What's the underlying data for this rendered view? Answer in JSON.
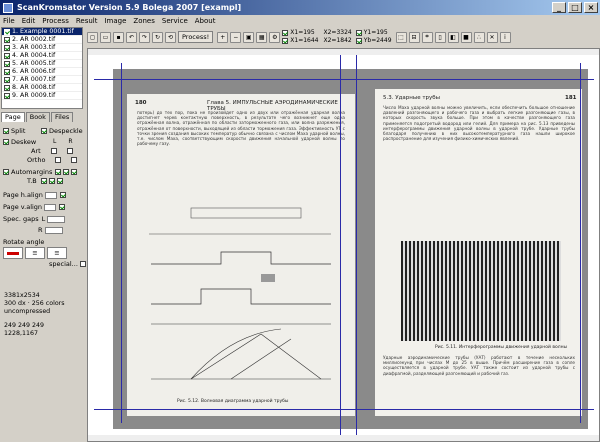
{
  "window": {
    "title": "ScanKromsator     Version 5.9     Bolega 2007     [exampl]"
  },
  "menu": [
    "File",
    "Edit",
    "Process",
    "Result",
    "Image",
    "Zones",
    "Service",
    "About"
  ],
  "files": [
    "1. Example 0001.tif",
    "2. AR 0002.tif",
    "3. AR 0003.tif",
    "4. AR 0004.tif",
    "5. AR 0005.tif",
    "6. AR 0006.tif",
    "7. AR 0007.tif",
    "8. AR 0008.tif",
    "9. AR 0009.tif"
  ],
  "toolbar": {
    "process_label": "Process!"
  },
  "coords": {
    "x1": "X1=195",
    "x2": "X2=3324",
    "y1": "Y1=195",
    "x1b": "X1=1644",
    "x2b": "X2=1842",
    "yb": "Yb=2449"
  },
  "tabs": [
    "Page",
    "Book",
    "Files"
  ],
  "panel": {
    "split": "Split",
    "despeckle": "Despeckle",
    "deskew": "Deskew",
    "art": "Art",
    "ortho": "Ortho",
    "automargins": "Automargins",
    "tb": "T.B",
    "page_h": "Page h.align",
    "page_v": "Page v.align",
    "spec_gaps": "Spec. gaps",
    "l": "L",
    "r": "R",
    "rotate": "Rotate angle",
    "special": "special..."
  },
  "status": {
    "dims": "3381x2534",
    "dpi": "300 dx · 256 colors",
    "comp": "uncompressed",
    "color": "249 249 249",
    "pos": "1228,1167"
  },
  "pages": {
    "left_num": "180",
    "left_header": "Глава 5. ИМПУЛЬСНЫЕ АЭРОДИНАМИЧЕСКИЕ ТРУБЫ",
    "right_num": "181",
    "right_header": "5.3. Ударные трубы",
    "fig_left": "Рис. 5.12. Волновая диаграмма ударной трубы",
    "fig_right": "Рис. 5.11. Интерферограммы движения ударной волны",
    "left_text": "потерь) до тех пор, пока не произойдет одно из двух или отражён­ная ударная волна достигнет черев контактную поверхность, в ре­зультате чего возникнет еще одна отражённая волна, отражённая по области заторможенного газа, или волна разрежения, отражён­ная от поверхности, выходящей из области торможения газа. Эффективность УТ с точки зрения создания высоких температур обычно связана с числом Маха ударной волны, т.е. числом Маха, соответствующим скорости движения начальной ударной волны по рабочему газу.",
    "right_text": "Число Маха ударной волны можно увеличить, если обеспечить большое отношение давлений разгоняющего и рабочего газа и вы­брать легкие разгоняющие газы, в которых скорость звука больше. При этом в качестве разгоняющего газа применяется подогретый водород или гелий. Для примера на рис. 5.13 приведены интерферограммы движения ударной волны в ударной трубе. Ударные трубы благодаря получению в них высокотемпературного газа нашли широкое распространение для изучения физико-химических явлений.",
    "right_bottom": "Ударные аэродинамические трубы (УАТ) работают в течение нескольких миллисекунд при числах M до 25 в выше. Причём расширение газа в сопле осуществляется в ударной трубе. УАТ также состоит из ударной трубы с диафрагмой, разделяющей разгоняющий и рабочий газ."
  }
}
